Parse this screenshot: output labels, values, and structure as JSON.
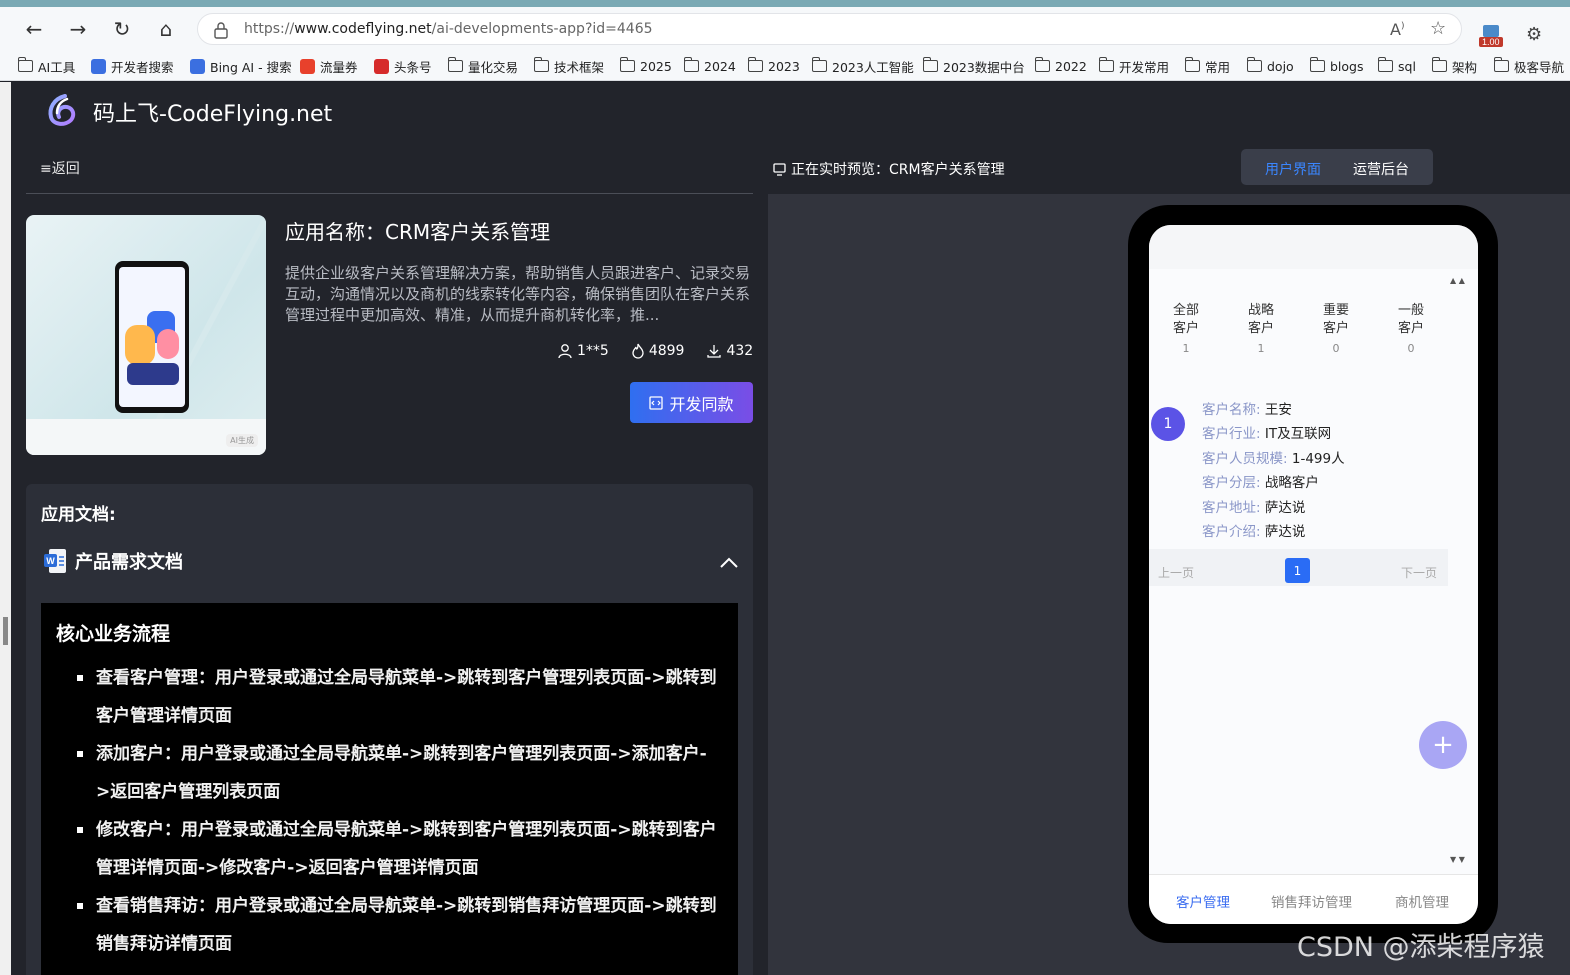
{
  "browser": {
    "url_prefix": "https://",
    "url_domain": "www.codeflying.net",
    "url_path": "/ai-developments-app?id=4465",
    "ext_badge": "1.00",
    "bookmarks": [
      {
        "label": "AI工具",
        "type": "folder"
      },
      {
        "label": "开发者搜索",
        "type": "site"
      },
      {
        "label": "Bing AI - 搜索",
        "type": "site"
      },
      {
        "label": "流量券",
        "type": "site"
      },
      {
        "label": "头条号",
        "type": "site"
      },
      {
        "label": "量化交易",
        "type": "folder"
      },
      {
        "label": "技术框架",
        "type": "folder"
      },
      {
        "label": "2025",
        "type": "folder"
      },
      {
        "label": "2024",
        "type": "folder"
      },
      {
        "label": "2023",
        "type": "folder"
      },
      {
        "label": "2023人工智能",
        "type": "folder"
      },
      {
        "label": "2023数据中台",
        "type": "folder"
      },
      {
        "label": "2022",
        "type": "folder"
      },
      {
        "label": "开发常用",
        "type": "folder"
      },
      {
        "label": "常用",
        "type": "folder"
      },
      {
        "label": "dojo",
        "type": "folder"
      },
      {
        "label": "blogs",
        "type": "folder"
      },
      {
        "label": "sql",
        "type": "folder"
      },
      {
        "label": "架构",
        "type": "folder"
      },
      {
        "label": "极客导航",
        "type": "folder"
      }
    ]
  },
  "site": {
    "name": "码上飞-CodeFlying.net"
  },
  "left": {
    "back_label": "≡返回",
    "app_title": "应用名称：CRM客户关系管理",
    "app_desc": "提供企业级客户关系管理解决方案，帮助销售人员跟进客户、记录交易互动，沟通情况以及商机的线索转化等内容，确保销售团队在客户关系管理过程中更加高效、精准，从而提升商机转化率，推...",
    "author": "1**5",
    "views": "4899",
    "downloads": "432",
    "dev_button": "开发同款",
    "thumb_tag": "AI生成"
  },
  "doc": {
    "label": "应用文档:",
    "section_title": "产品需求文档",
    "heading": "核心业务流程",
    "items": [
      "查看客户管理：用户登录或通过全局导航菜单->跳转到客户管理列表页面->跳转到客户管理详情页面",
      "添加客户：用户登录或通过全局导航菜单->跳转到客户管理列表页面->添加客户->返回客户管理列表页面",
      "修改客户：用户登录或通过全局导航菜单->跳转到客户管理列表页面->跳转到客户管理详情页面->修改客户->返回客户管理详情页面",
      "查看销售拜访：用户登录或通过全局导航菜单->跳转到销售拜访管理页面->跳转到销售拜访详情页面"
    ]
  },
  "preview": {
    "label": "正在实时预览：CRM客户关系管理",
    "toggle_user": "用户界面",
    "toggle_admin": "运营后台",
    "categories": [
      {
        "l1": "全部",
        "l2": "客户",
        "count": "1"
      },
      {
        "l1": "战略",
        "l2": "客户",
        "count": "1"
      },
      {
        "l1": "重要",
        "l2": "客户",
        "count": "0"
      },
      {
        "l1": "一般",
        "l2": "客户",
        "count": "0"
      }
    ],
    "card_index": "1",
    "fields": [
      {
        "k": "客户名称:",
        "v": "王安"
      },
      {
        "k": "客户行业:",
        "v": "IT及互联网"
      },
      {
        "k": "客户人员规模:",
        "v": "1-499人"
      },
      {
        "k": "客户分层:",
        "v": "战略客户"
      },
      {
        "k": "客户地址:",
        "v": "萨达说"
      },
      {
        "k": "客户介绍:",
        "v": "萨达说"
      }
    ],
    "pager_prev": "上一页",
    "pager_current": "1",
    "pager_next": "下一页",
    "fab": "+",
    "tabs": [
      "客户管理",
      "销售拜访管理",
      "商机管理"
    ]
  },
  "watermark": "CSDN @添柴程序猿",
  "colors": {
    "accent_blue": "#2f6ff0",
    "accent_purple": "#7a4de6",
    "active_tab": "#3a6cf0",
    "page_bg": "#22242b"
  }
}
